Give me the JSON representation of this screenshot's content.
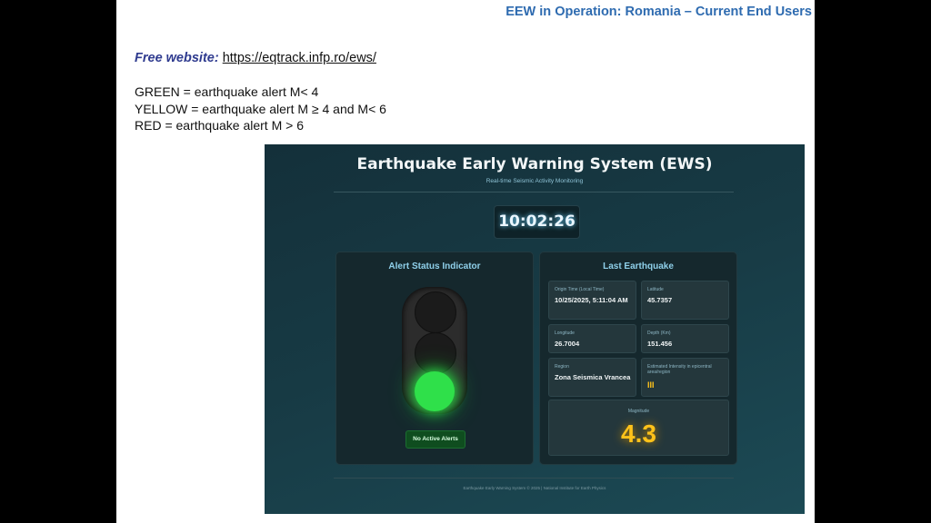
{
  "slide": {
    "title": "EEW in Operation: Romania – Current End Users",
    "website_label": "Free website:",
    "website_url": "https://eqtrack.infp.ro/ews/",
    "legend": [
      "GREEN = earthquake alert M< 4",
      "YELLOW = earthquake alert M ≥ 4 and M< 6",
      "RED = earthquake alert M > 6"
    ]
  },
  "ews": {
    "title": "Earthquake Early Warning System (EWS)",
    "subtitle": "Real-time Seismic Activity Monitoring",
    "clock": "10:02:26",
    "alert_panel": {
      "title": "Alert Status Indicator",
      "active_light": "green",
      "status_button": "No Active Alerts"
    },
    "quake_panel": {
      "title": "Last Earthquake",
      "origin_label": "Origin Time (Local Time)",
      "origin_value": "10/25/2025, 5:11:04 AM",
      "latitude_label": "Latitude",
      "latitude_value": "45.7357",
      "longitude_label": "Longitude",
      "longitude_value": "26.7004",
      "depth_label": "Depth (Km)",
      "depth_value": "151.456",
      "region_label": "Region",
      "region_value": "Zona Seismica Vrancea",
      "intensity_label": "Estimated Intensity in epicentral area/region",
      "intensity_value": "III",
      "magnitude_label": "Magnitude",
      "magnitude_value": "4.3"
    },
    "footer": "Earthquake Early Warning System © 2025 | National Institute for Earth Physics"
  },
  "colors": {
    "slide_title": "#2e6bb0",
    "green_light": "#2fe04a",
    "magnitude": "#ffc21a"
  }
}
